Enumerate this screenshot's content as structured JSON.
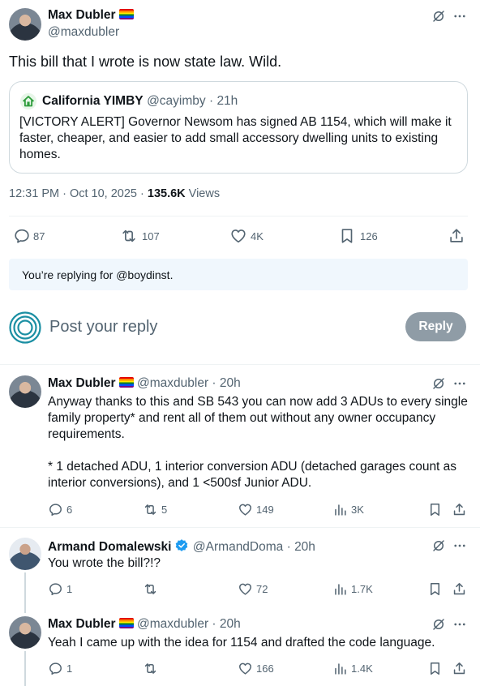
{
  "main_post": {
    "author_name": "Max Dubler",
    "author_handle": "@maxdubler",
    "text": "This bill that I wrote is now state law. Wild.",
    "quote": {
      "author_name": "California YIMBY",
      "author_handle": "@cayimby",
      "time": "21h",
      "text": "[VICTORY ALERT] Governor Newsom has signed AB 1154, which will make it faster, cheaper, and easier to add small accessory dwelling units to existing homes."
    },
    "timestamp": "12:31 PM · Oct 10, 2025 · ",
    "views_count": "135.6K",
    "views_label": " Views",
    "replies": "87",
    "reposts": "107",
    "likes": "4K",
    "bookmarks": "126"
  },
  "reply_notice": {
    "text": "You’re replying for @boydinst."
  },
  "composer": {
    "placeholder": "Post your reply",
    "reply_button": "Reply"
  },
  "replies": [
    {
      "author_name": "Max Dubler",
      "author_handle": "@maxdubler",
      "time": "20h",
      "text_p1": "Anyway thanks to this and SB 543 you can now add 3 ADUs to every single family property* and rent all of them out without any owner occupancy requirements.",
      "text_p2": "* 1 detached ADU, 1 interior conversion ADU (detached garages count as interior conversions), and 1 <500sf Junior ADU.",
      "replies": "6",
      "reposts": "5",
      "likes": "149",
      "views": "3K"
    },
    {
      "author_name": "Armand Domalewski",
      "author_handle": "@ArmandDoma",
      "time": "20h",
      "text": "You wrote the bill?!?",
      "replies": "1",
      "reposts": "",
      "likes": "72",
      "views": "1.7K"
    },
    {
      "author_name": "Max Dubler",
      "author_handle": "@maxdubler",
      "time": "20h",
      "text": "Yeah I came up with the idea for 1154 and drafted the code language.",
      "replies": "1",
      "reposts": "",
      "likes": "166",
      "views": "1.4K"
    }
  ],
  "colors": {
    "text": "#0f1419",
    "secondary": "#536471",
    "accent": "#1d9bf0",
    "border": "#cfd9de",
    "yimby_green": "#4caf50"
  }
}
